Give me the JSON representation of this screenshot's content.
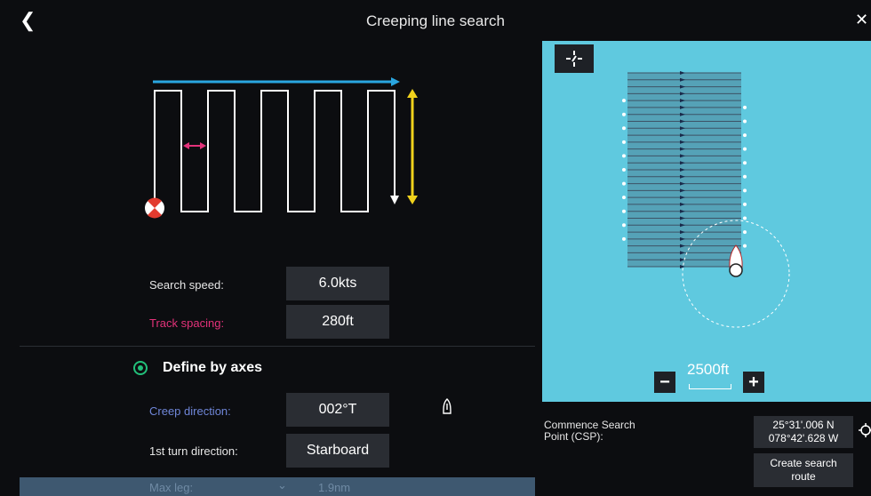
{
  "header": {
    "title": "Creeping line search",
    "back_icon": "chevron-left-icon",
    "close_icon": "close-icon"
  },
  "form": {
    "search_speed": {
      "label": "Search speed:",
      "value": "6.0kts"
    },
    "track_spacing": {
      "label": "Track spacing:",
      "value": "280ft",
      "color": "#e3327a"
    },
    "define_by_axes": {
      "label": "Define by axes",
      "selected": true
    },
    "creep_direction": {
      "label": "Creep direction:",
      "value": "002°T",
      "color": "#6f86d8"
    },
    "first_turn": {
      "label": "1st turn direction:",
      "value": "Starboard"
    },
    "partial_row": {
      "label": "Max leg:",
      "value": "1.9nm"
    }
  },
  "map": {
    "scale_label": "2500ft",
    "zoom_out": "−",
    "zoom_in": "+",
    "water_color": "#5fc9df"
  },
  "csp": {
    "label_line1": "Commence Search",
    "label_line2": "Point (CSP):",
    "lat": "25°31'.006 N",
    "lon": "078°42'.628 W"
  },
  "create_route": {
    "line1": "Create search",
    "line2": "route"
  }
}
